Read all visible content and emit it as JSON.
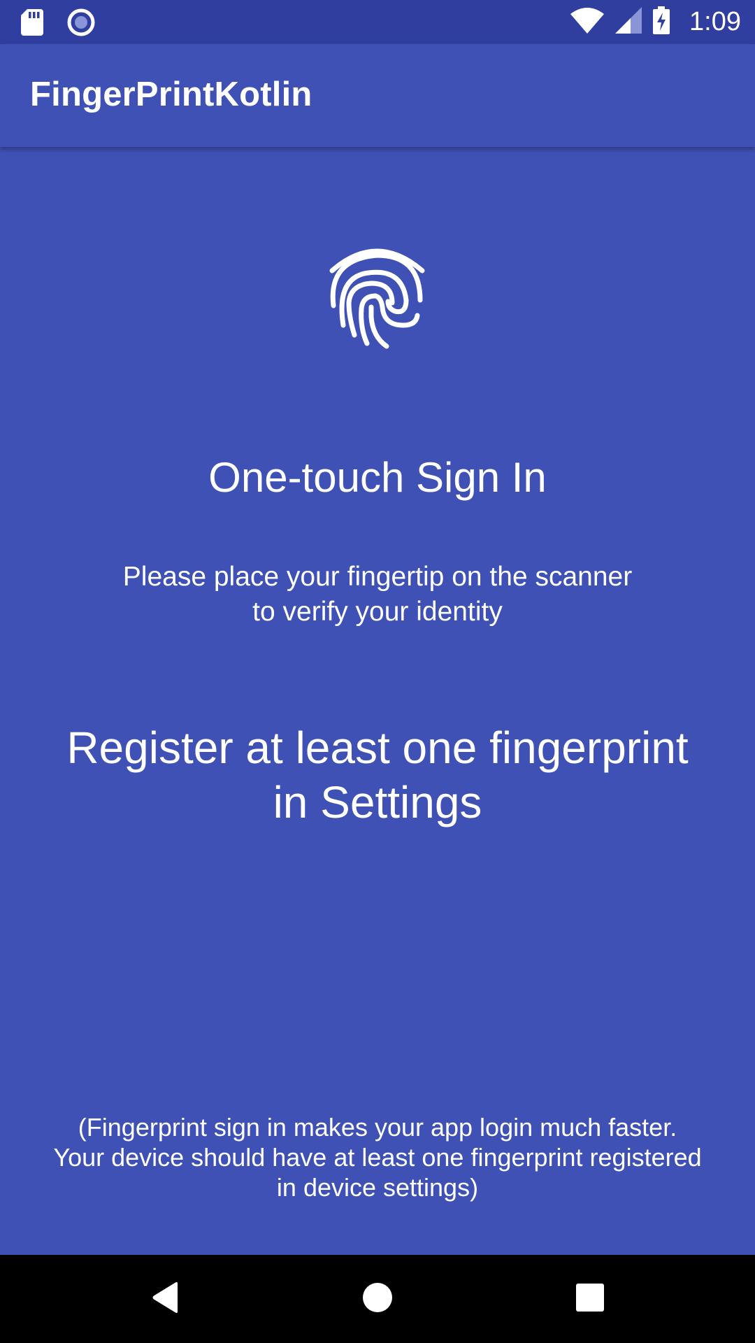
{
  "status_bar": {
    "time": "1:09",
    "left_icons": [
      "sd-card-icon",
      "record-icon"
    ],
    "right_icons": [
      "wifi-icon",
      "cellular-signal-icon",
      "battery-charging-icon"
    ]
  },
  "app_bar": {
    "title": "FingerPrintKotlin"
  },
  "main": {
    "icon": "fingerprint-icon",
    "headline": "One-touch Sign In",
    "instruction_line1": "Please place your fingertip on the scanner",
    "instruction_line2": "to verify your identity",
    "warning_line1": "Register at least one fingerprint",
    "warning_line2": "in Settings",
    "note_line1": "(Fingerprint sign in makes your app login much faster.",
    "note_line2": "Your device should have at least one fingerprint registered",
    "note_line3": "in device settings)"
  },
  "nav_bar": {
    "buttons": [
      "back-icon",
      "home-icon",
      "recents-icon"
    ]
  },
  "colors": {
    "primary": "#3F51B5",
    "primary_dark": "#303F9F",
    "nav_bar": "#000000",
    "text": "#FFFFFF"
  }
}
